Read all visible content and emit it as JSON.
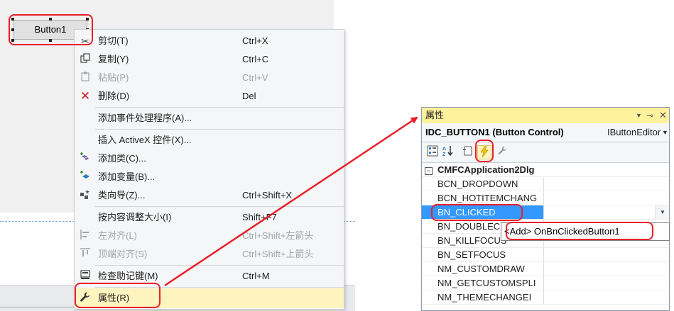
{
  "designer": {
    "button_caption": "Button1"
  },
  "context_menu": {
    "items": [
      {
        "label": "剪切(T)",
        "shortcut": "Ctrl+X",
        "icon": "scissors-icon",
        "disabled": false
      },
      {
        "label": "复制(Y)",
        "shortcut": "Ctrl+C",
        "icon": "copy-icon",
        "disabled": false
      },
      {
        "label": "粘贴(P)",
        "shortcut": "Ctrl+V",
        "icon": "paste-icon",
        "disabled": true
      },
      {
        "label": "删除(D)",
        "shortcut": "Del",
        "icon": "delete-icon",
        "disabled": false
      },
      {
        "label": "添加事件处理程序(A)...",
        "shortcut": "",
        "icon": "",
        "disabled": false
      },
      {
        "label": "插入 ActiveX 控件(X)...",
        "shortcut": "",
        "icon": "",
        "disabled": false
      },
      {
        "label": "添加类(C)...",
        "shortcut": "",
        "icon": "add-class-icon",
        "disabled": false
      },
      {
        "label": "添加变量(B)...",
        "shortcut": "",
        "icon": "add-variable-icon",
        "disabled": false
      },
      {
        "label": "类向导(Z)...",
        "shortcut": "Ctrl+Shift+X",
        "icon": "class-wizard-icon",
        "disabled": false
      },
      {
        "label": "按内容调整大小(I)",
        "shortcut": "Shift+F7",
        "icon": "",
        "disabled": false
      },
      {
        "label": "左对齐(L)",
        "shortcut": "Ctrl+Shift+左箭头",
        "icon": "align-left-icon",
        "disabled": true
      },
      {
        "label": "顶端对齐(S)",
        "shortcut": "Ctrl+Shift+上箭头",
        "icon": "align-top-icon",
        "disabled": true
      },
      {
        "label": "检查助记键(M)",
        "shortcut": "Ctrl+M",
        "icon": "check-mnemonics-icon",
        "disabled": false
      },
      {
        "label": "属性(R)",
        "shortcut": "",
        "icon": "wrench-icon",
        "disabled": false,
        "highlighted": true
      }
    ]
  },
  "properties": {
    "title": "属性",
    "object_name": "IDC_BUTTON1 (Button Control)",
    "object_type": "IButtonEditor",
    "category": "CMFCApplication2Dlg",
    "events": [
      {
        "name": "BCN_DROPDOWN"
      },
      {
        "name": "BCN_HOTITEMCHANG"
      },
      {
        "name": "BN_CLICKED",
        "selected": true
      },
      {
        "name": "BN_DOUBLEC"
      },
      {
        "name": "BN_KILLFOCUS"
      },
      {
        "name": "BN_SETFOCUS"
      },
      {
        "name": "NM_CUSTOMDRAW"
      },
      {
        "name": "NM_GETCUSTOMSPLI"
      },
      {
        "name": "NM_THEMECHANGEI"
      }
    ],
    "dropdown_option": "<Add> OnBnClickedButton1"
  },
  "colors": {
    "annotation_red": "#e8202a",
    "menu_highlight": "#fdf4bf",
    "properties_title": "#fff29d",
    "selection_blue": "#3399ff"
  }
}
